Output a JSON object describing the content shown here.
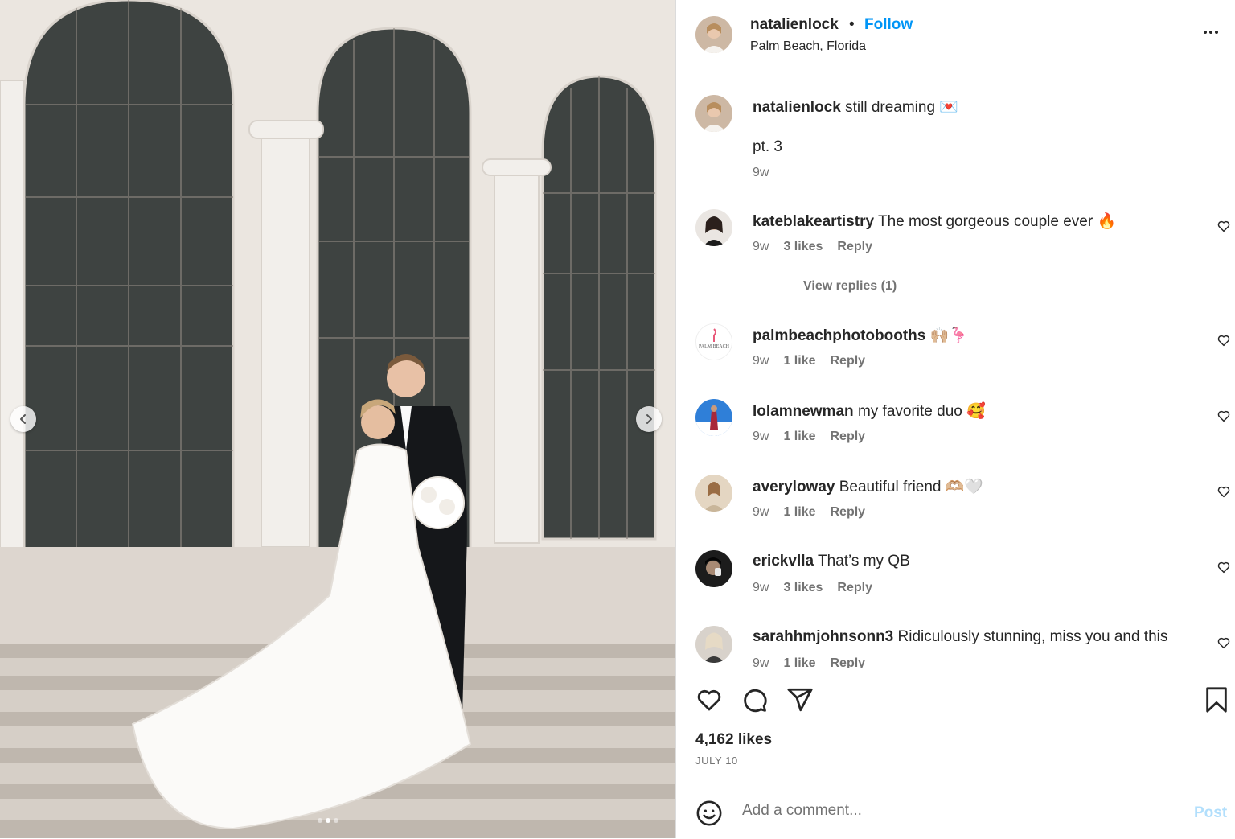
{
  "post": {
    "username": "natalienlock",
    "separator": "•",
    "follow_label": "Follow",
    "location": "Palm Beach, Florida",
    "caption_line1": "still dreaming 💌",
    "caption_line2": "pt. 3",
    "caption_age": "9w"
  },
  "comments": [
    {
      "username": "kateblakeartistry",
      "text": "The most gorgeous couple ever 🔥",
      "age": "9w",
      "likes": "3 likes",
      "reply": "Reply",
      "avatar_color": "#5a4a44"
    },
    {
      "username": "palmbeachphotobooths",
      "text": "🙌🏼🦩",
      "age": "9w",
      "likes": "1 like",
      "reply": "Reply",
      "avatar_color": "#ffffff"
    },
    {
      "username": "lolamnewman",
      "text": "my favorite duo 🥰",
      "age": "9w",
      "likes": "1 like",
      "reply": "Reply",
      "avatar_color": "#2f7fd8"
    },
    {
      "username": "averyloway",
      "text": "Beautiful friend 🫶🏼🤍",
      "age": "9w",
      "likes": "1 like",
      "reply": "Reply",
      "avatar_color": "#d9c6ad"
    },
    {
      "username": "erickvlla",
      "text": "That’s my QB",
      "age": "9w",
      "likes": "3 likes",
      "reply": "Reply",
      "avatar_color": "#2b2b2b"
    },
    {
      "username": "sarahhmjohnsonn3",
      "text": "Ridiculously stunning, miss you and this",
      "age": "9w",
      "likes": "1 like",
      "reply": "Reply",
      "avatar_color": "#b9b1a6"
    }
  ],
  "view_replies_label": "View replies (1)",
  "palm_avatar_text": "PALM BEACH",
  "likes_count": "4,162 likes",
  "post_date": "JULY 10",
  "add_comment_placeholder": "Add a comment...",
  "post_button": "Post",
  "colors": {
    "accent": "#0095f6",
    "text": "#262626",
    "muted": "#737373"
  },
  "icons": [
    "chevron-left-icon",
    "chevron-right-icon",
    "more-icon",
    "heart-icon",
    "comment-icon",
    "share-icon",
    "bookmark-icon",
    "emoji-icon"
  ]
}
